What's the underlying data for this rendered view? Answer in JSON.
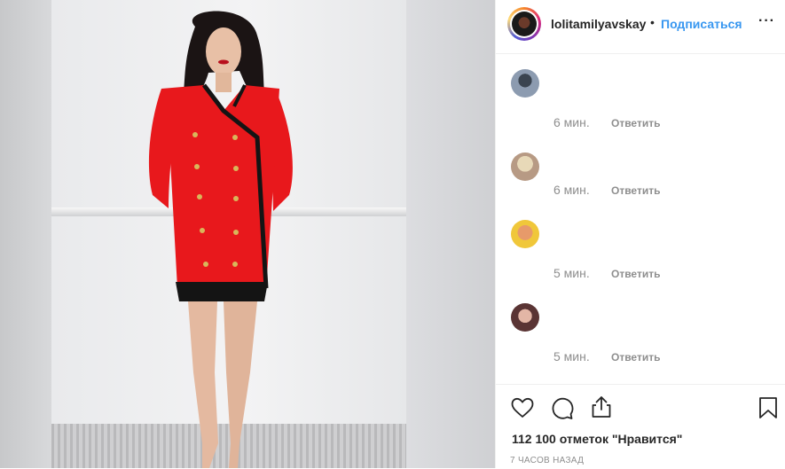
{
  "header": {
    "username": "lolitamilyavskay",
    "dot": "•",
    "follow_label": "Подписаться",
    "more_label": "···"
  },
  "comments": [
    {
      "time": "6 мин.",
      "reply_label": "Ответить",
      "avatar_color": "#7a8aa0"
    },
    {
      "time": "6 мин.",
      "reply_label": "Ответить",
      "avatar_color": "#c9a98b"
    },
    {
      "time": "5 мин.",
      "reply_label": "Ответить",
      "avatar_color": "#e8c23a"
    },
    {
      "time": "5 мин.",
      "reply_label": "Ответить",
      "avatar_color": "#8a5a5a"
    }
  ],
  "actions": {
    "likes_text": "112 100 отметок \"Нравится\"",
    "time_ago": "7 ЧАСОВ НАЗАД"
  },
  "colors": {
    "accent": "#3897f0",
    "dress": "#e8181c"
  }
}
